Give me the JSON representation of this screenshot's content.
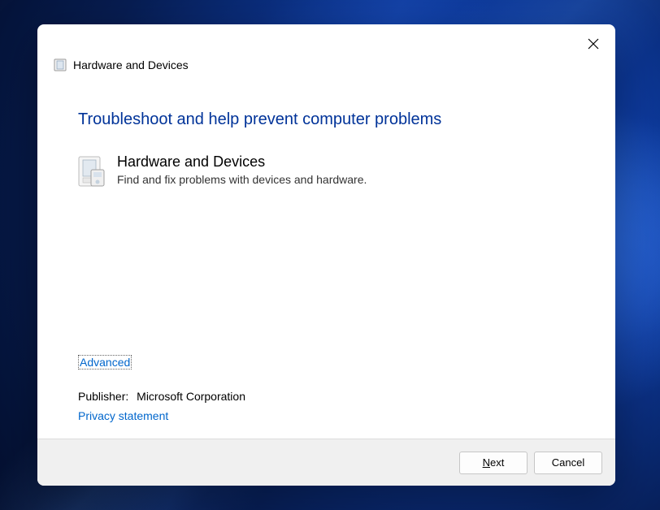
{
  "header": {
    "title": "Hardware and Devices"
  },
  "main": {
    "heading": "Troubleshoot and help prevent computer problems",
    "troubleshooter": {
      "name": "Hardware and Devices",
      "description": "Find and fix problems with devices and hardware."
    },
    "advanced_link": "Advanced",
    "publisher_label": "Publisher:",
    "publisher_name": "Microsoft Corporation",
    "privacy_link": "Privacy statement"
  },
  "buttons": {
    "next": "Next",
    "next_prefix": "N",
    "next_suffix": "ext",
    "cancel": "Cancel"
  }
}
